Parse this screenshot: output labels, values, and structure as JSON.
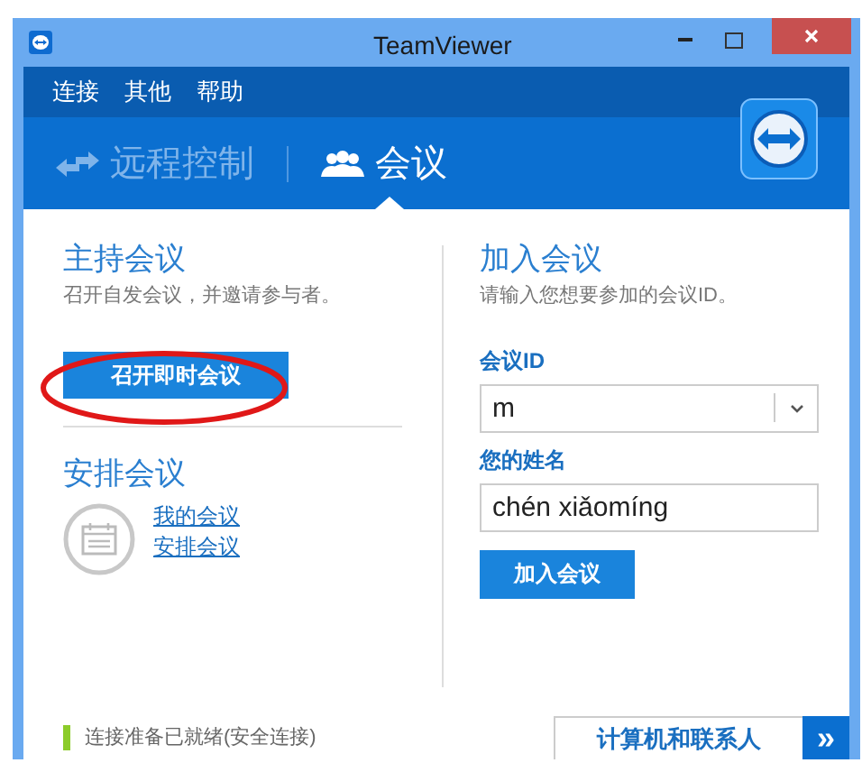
{
  "window": {
    "title": "TeamViewer"
  },
  "menu": [
    "连接",
    "其他",
    "帮助"
  ],
  "tabs": [
    {
      "label": "远程控制",
      "selected": false
    },
    {
      "label": "会议",
      "selected": true
    }
  ],
  "host": {
    "title": "主持会议",
    "description": "召开自发会议，并邀请参与者。",
    "button": "召开即时会议"
  },
  "schedule": {
    "title": "安排会议",
    "links": [
      "我的会议",
      "安排会议"
    ]
  },
  "join": {
    "title": "加入会议",
    "description": "请输入您想要参加的会议ID。",
    "id_label": "会议ID",
    "id_value": "m",
    "name_label": "您的姓名",
    "name_value": "chén xiǎomíng",
    "button": "加入会议"
  },
  "status_bar": {
    "text": "连接准备已就绪(安全连接)",
    "contacts_tab": "计算机和联系人",
    "expand": "»"
  },
  "annotation": {
    "kind": "ellipse"
  }
}
